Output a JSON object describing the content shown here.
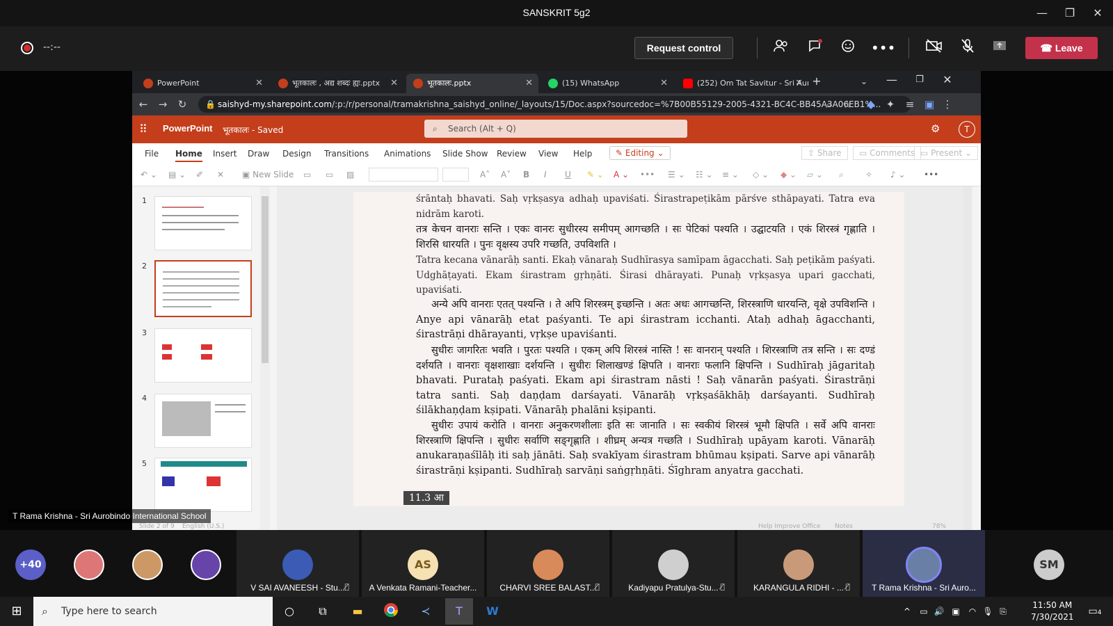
{
  "window": {
    "title": "SANSKRIT 5g2",
    "minimize": "—",
    "restore": "❐",
    "close": "✕"
  },
  "meeting": {
    "timer": "--:--",
    "request_control": "Request control",
    "leave": "Leave",
    "icons": [
      "people-icon",
      "chat-icon",
      "reactions-icon",
      "more-icon",
      "camera-off-icon",
      "mic-off-icon",
      "share-icon"
    ]
  },
  "browser": {
    "tabs": [
      {
        "label": "PowerPoint",
        "color": "#c43e1c"
      },
      {
        "label": "भूतकालः , अद्य शब्दः ह्यः.pptx",
        "color": "#c43e1c"
      },
      {
        "label": "भूतकालः.pptx",
        "color": "#c43e1c"
      },
      {
        "label": "(15) WhatsApp",
        "color": "#25d366"
      },
      {
        "label": "(252) Om Tat Savitur - Sri Aur",
        "color": "#ff0000"
      }
    ],
    "new_tab": "+",
    "url_host": "saishyd-my.sharepoint.com",
    "url_path": "/:p:/r/personal/tramakrishna_saishyd_online/_layouts/15/Doc.aspx?sourcedoc=%7B00B55129-2005-4321-BC4C-BB45A3A06EB1%..."
  },
  "ppt": {
    "app_name": "PowerPoint",
    "doc_name": "भूतकालः - Saved",
    "search_placeholder": "Search (Alt + Q)",
    "user_initial": "T",
    "menus": [
      "File",
      "Home",
      "Insert",
      "Draw",
      "Design",
      "Transitions",
      "Animations",
      "Slide Show",
      "Review",
      "View",
      "Help"
    ],
    "editing": "Editing",
    "share": "Share",
    "comments": "Comments",
    "present": "Present",
    "new_slide": "New Slide",
    "thumb_numbers": [
      "1",
      "2",
      "3",
      "4",
      "5"
    ],
    "slide_lines": [
      "śrāntaḥ bhavati. Saḥ vṛkṣasya adhaḥ upaviśati. Śirastrapeṭikām pārśve sthāpayati. Tatra eva nidrām karoti.",
      "तत्र केचन वानराः सन्ति । एकः वानरः सुधीरस्य समीपम् आगच्छति । सः पेटिकां पश्यति । उद्घाटयति । एकं शिरस्त्रं गृह्णाति । शिरसि धारयति । पुनः वृक्षस्य उपरि गच्छति, उपविशति ।",
      "Tatra kecana vānarāḥ santi. Ekaḥ vānaraḥ Sudhīrasya samīpam āgacchati. Saḥ peṭikām paśyati. Udghāṭayati. Ekam śirastram gṛhṇāti. Śirasi dhārayati. Punaḥ vṛkṣasya upari gacchati, upaviśati.",
      "अन्ये अपि वानराः एतत् पश्यन्ति । ते अपि शिरस्त्रम् इच्छन्ति । अतः अधः आगच्छन्ति, शिरस्त्राणि धारयन्ति, वृक्षे उपविशन्ति । Anye api vānarāḥ etat paśyanti. Te api śirastram icchanti. Ataḥ adhaḥ āgacchanti, śirastrāṇi dhārayanti, vṛkṣe upaviśanti.",
      "सुधीरः जागरितः भवति । पुरतः पश्यति । एकम् अपि शिरस्त्रं नास्ति ! सः वानरान् पश्यति । शिरस्त्राणि तत्र सन्ति । सः दण्डं दर्शयति । वानराः वृक्षशाखाः दर्शयन्ति । सुधीरः शिलाखण्डं क्षिपति । वानराः फलानि क्षिपन्ति । Sudhīraḥ jāgaritaḥ bhavati. Purataḥ paśyati. Ekam api śirastram nāsti ! Saḥ vānarān paśyati. Śirastrāṇi tatra santi. Saḥ daṇḍam darśayati. Vānarāḥ vṛkṣaśākhāḥ darśayanti. Sudhīraḥ śilākhaṇḍam kṣipati. Vānarāḥ phalāni kṣipanti.",
      "सुधीरः उपायं करोति । वानराः अनुकरणशीलाः इति सः जानाति । सः स्वकीयं शिरस्त्रं भूमौ क्षिपति । सर्वे अपि वानराः शिरस्त्राणि क्षिपन्ति । सुधीरः सर्वाणि सङ्गृह्णाति । शीघ्रम् अन्यत्र गच्छति । Sudhīraḥ upāyam karoti. Vānarāḥ anukaraṇaśīlāḥ iti saḥ jānāti. Saḥ svakīyam śirastram bhūmau kṣipati. Sarve api vānarāḥ śirastrāṇi kṣipanti. Sudhīraḥ sarvāṇi saṅgṛhṇāti. Śīghram anyatra gacchati."
    ],
    "slide_label": "11.3 आ",
    "status_slide": "Slide 2 of 9",
    "status_lang": "English (U.S.)",
    "status_help": "Help Improve Office",
    "status_notes": "Notes",
    "status_zoom": "78%"
  },
  "speaker_label": "T Rama Krishna - Sri Aurobindo International School",
  "participants": {
    "overflow_count": "+40",
    "tiles": [
      {
        "name": "V SAI AVANEESH - Stu...",
        "color": "#3b5bb5"
      },
      {
        "name": "A Venkata Ramani-Teacher...",
        "initials": "AS",
        "color": "#f6e1b3"
      },
      {
        "name": "CHARVI SREE BALAST...",
        "color": "#d98a5a"
      },
      {
        "name": "Kadiyapu Pratulya-Stu...",
        "color": "#cfcfcf"
      },
      {
        "name": "KARANGULA RIDHI - ...",
        "color": "#c99a7a"
      },
      {
        "name": "T Rama Krishna - Sri Auro...",
        "color": "#6a7fa5"
      }
    ],
    "last_initials": "SM"
  },
  "taskbar": {
    "search_placeholder": "Type here to search",
    "time": "11:50 AM",
    "date": "7/30/2021",
    "notifications": "4"
  }
}
